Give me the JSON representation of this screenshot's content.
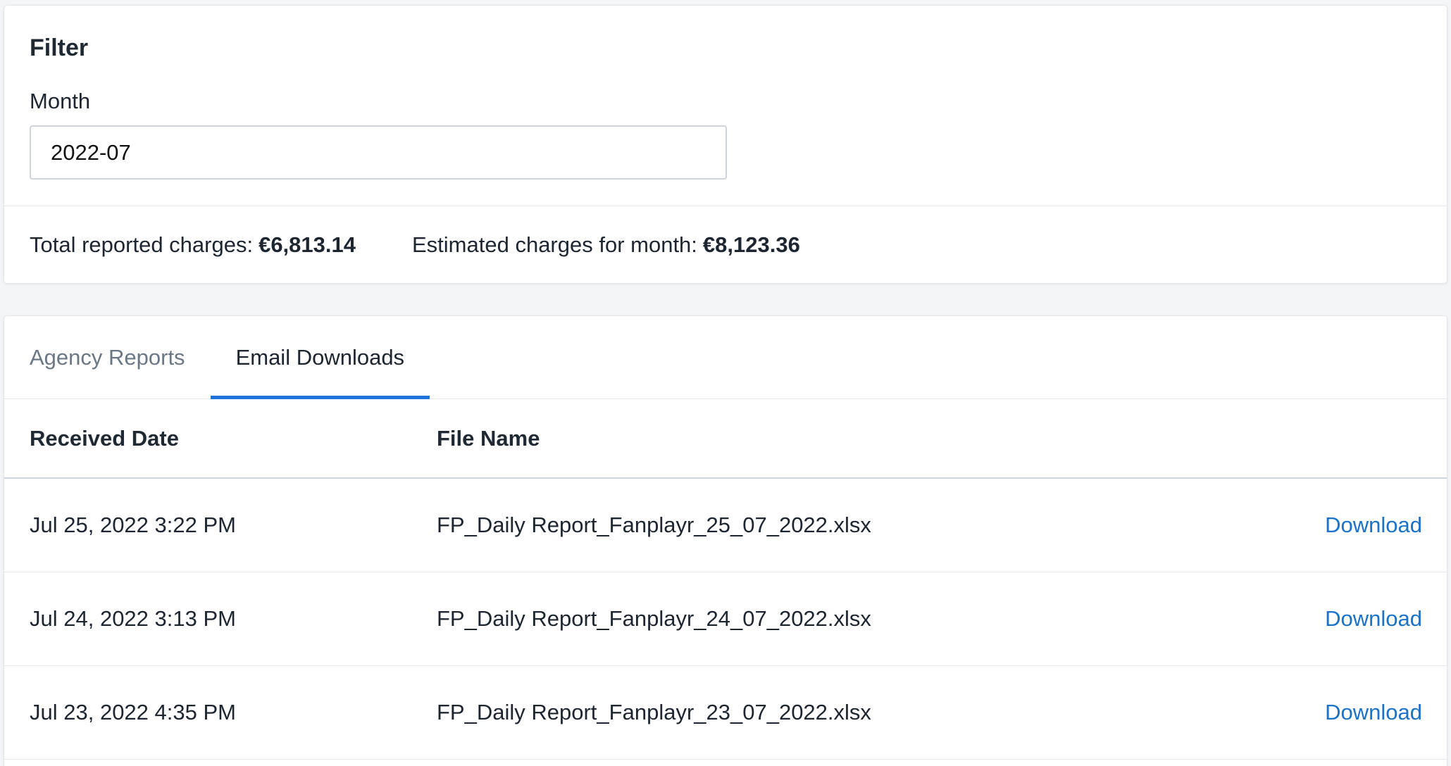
{
  "filter": {
    "title": "Filter",
    "month_label": "Month",
    "month_value": "2022-07"
  },
  "charges": {
    "total_label": "Total reported charges:",
    "total_value": "€6,813.14",
    "estimated_label": "Estimated charges for month:",
    "estimated_value": "€8,123.36"
  },
  "tabs": [
    {
      "label": "Agency Reports",
      "active": false
    },
    {
      "label": "Email Downloads",
      "active": true
    }
  ],
  "table": {
    "headers": {
      "received_date": "Received Date",
      "file_name": "File Name"
    },
    "rows": [
      {
        "date": "Jul 25, 2022 3:22 PM",
        "file": "FP_Daily Report_Fanplayr_25_07_2022.xlsx",
        "action": "Download"
      },
      {
        "date": "Jul 24, 2022 3:13 PM",
        "file": "FP_Daily Report_Fanplayr_24_07_2022.xlsx",
        "action": "Download"
      },
      {
        "date": "Jul 23, 2022 4:35 PM",
        "file": "FP_Daily Report_Fanplayr_23_07_2022.xlsx",
        "action": "Download"
      }
    ]
  },
  "colors": {
    "accent": "#1f73db",
    "link": "#1a73c9",
    "background": "#f4f5f7"
  }
}
